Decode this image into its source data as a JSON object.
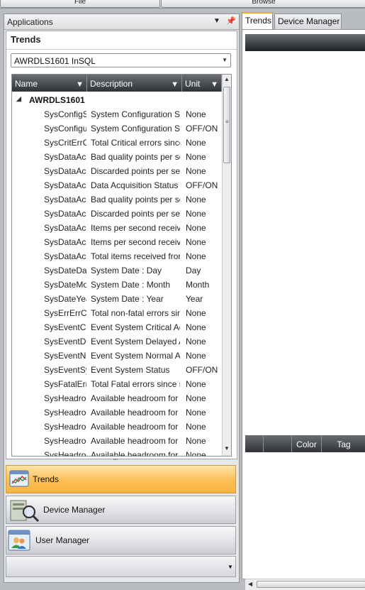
{
  "menu": {
    "file_label": "File",
    "browse_label": "Browse"
  },
  "left_panel": {
    "header": "Applications",
    "trends_title": "Trends",
    "server_select": "AWRDLS1601 InSQL",
    "grid": {
      "columns": [
        "Name",
        "Description",
        "Unit"
      ],
      "group": "AWRDLS1601",
      "rows": [
        {
          "name": "SysConfigS",
          "desc": "System Configuration St",
          "unit": "None"
        },
        {
          "name": "SysConfigu",
          "desc": "System Configuration St",
          "unit": "OFF/ON"
        },
        {
          "name": "SysCritErrC",
          "desc": "Total Critical errors since",
          "unit": "None"
        },
        {
          "name": "SysDataAcc",
          "desc": "Bad quality points per se",
          "unit": "None"
        },
        {
          "name": "SysDataAcc",
          "desc": "Discarded points per sec",
          "unit": "None"
        },
        {
          "name": "SysDataAcc",
          "desc": "Data Acquisition Status",
          "unit": "OFF/ON"
        },
        {
          "name": "SysDataAcc",
          "desc": "Bad quality points per se",
          "unit": "None"
        },
        {
          "name": "SysDataAcc",
          "desc": "Discarded points per sec",
          "unit": "None"
        },
        {
          "name": "SysDataAcc",
          "desc": "Items per second receiv",
          "unit": "None"
        },
        {
          "name": "SysDataAcc",
          "desc": "Items per second receiv",
          "unit": "None"
        },
        {
          "name": "SysDataAcc",
          "desc": "Total items received fror",
          "unit": "None"
        },
        {
          "name": "SysDateDay",
          "desc": "System Date : Day",
          "unit": "Day"
        },
        {
          "name": "SysDateMo",
          "desc": "System Date : Month",
          "unit": "Month"
        },
        {
          "name": "SysDateYea",
          "desc": "System Date : Year",
          "unit": "Year"
        },
        {
          "name": "SysErrErrCn",
          "desc": "Total non-fatal errors sir",
          "unit": "None"
        },
        {
          "name": "SysEventCr",
          "desc": "Event System Critical Ac",
          "unit": "None"
        },
        {
          "name": "SysEventDe",
          "desc": "Event System Delayed A",
          "unit": "None"
        },
        {
          "name": "SysEventNo",
          "desc": "Event System Normal Ac",
          "unit": "None"
        },
        {
          "name": "SysEventSy",
          "desc": "Event System Status",
          "unit": "OFF/ON"
        },
        {
          "name": "SysFatalErr",
          "desc": "Total Fatal errors since s",
          "unit": "None"
        },
        {
          "name": "SysHeadroo",
          "desc": "Available headroom for",
          "unit": "None"
        },
        {
          "name": "SysHeadroo",
          "desc": "Available headroom for",
          "unit": "None"
        },
        {
          "name": "SysHeadroo",
          "desc": "Available headroom for",
          "unit": "None"
        },
        {
          "name": "SysHeadroo",
          "desc": "Available headroom for",
          "unit": "None"
        },
        {
          "name": "SysHeadroo",
          "desc": "Available headroom for",
          "unit": "None"
        }
      ]
    },
    "nav": {
      "trends": "Trends",
      "device_manager": "Device Manager",
      "user_manager": "User Manager"
    }
  },
  "right_panel": {
    "tabs": [
      "Trends",
      "Device Manager"
    ],
    "tag_columns": [
      "",
      "",
      "Color",
      "Tag"
    ]
  },
  "colors": {
    "active_nav": "#fbbe56",
    "header_dark": "#2f3236",
    "active_tab_accent": "#f0a92d"
  }
}
